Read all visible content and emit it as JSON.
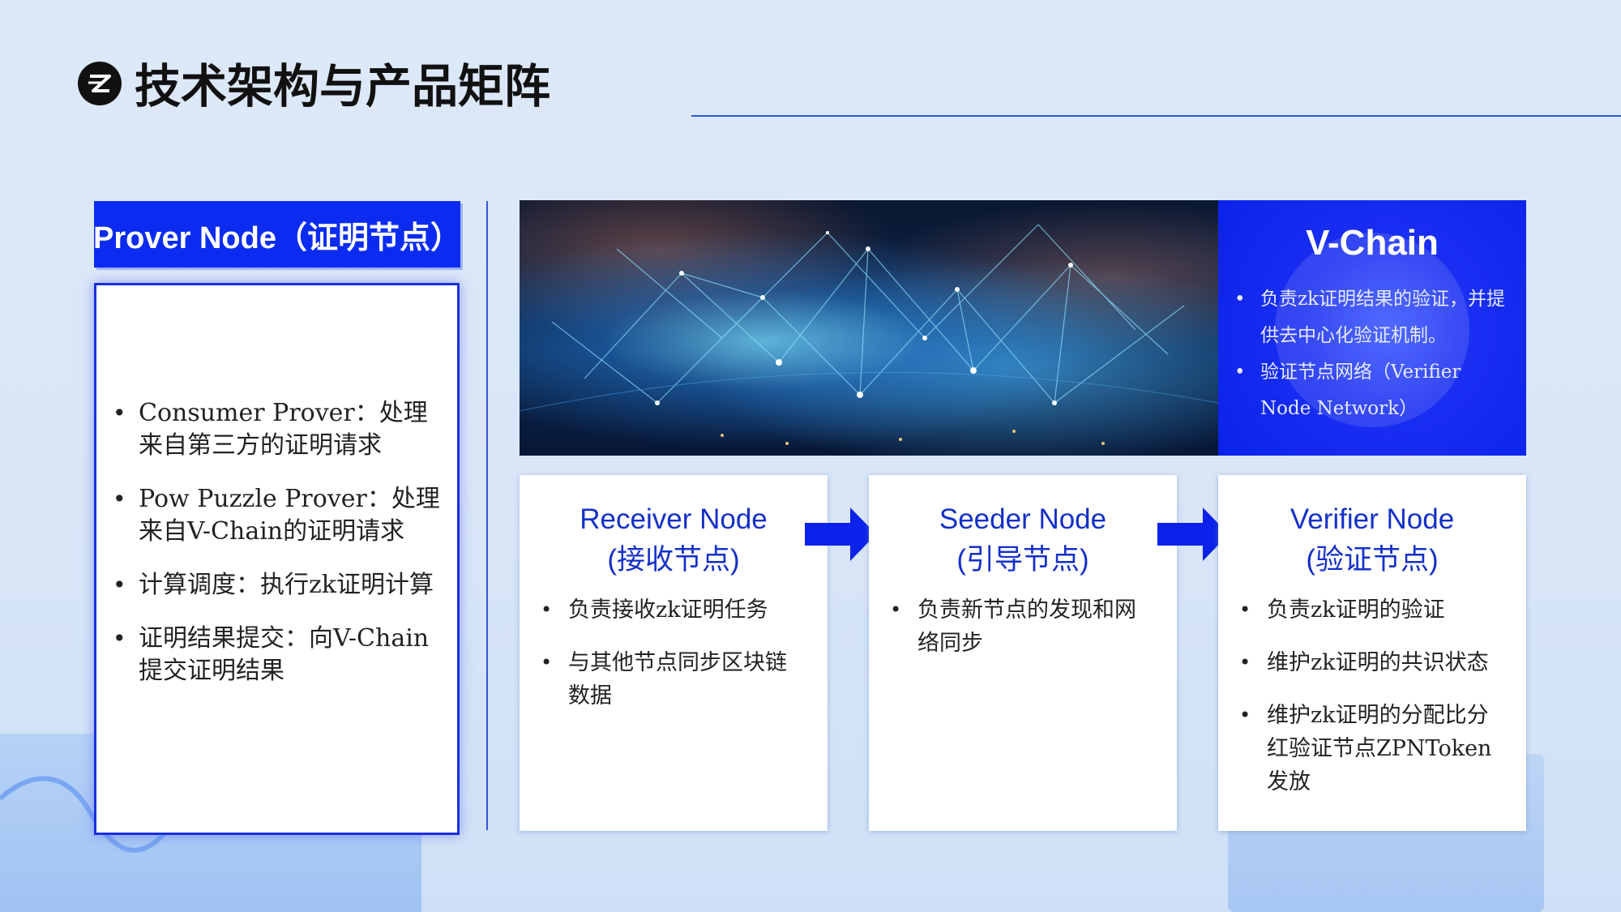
{
  "title": "技术架构与产品矩阵",
  "colors": {
    "accent": "#0b2cf0",
    "card_title": "#1430c8"
  },
  "prover": {
    "header": "Prover Node（证明节点）",
    "items": [
      "Consumer Prover：处理来自第三方的证明请求",
      "Pow Puzzle Prover：处理来自V-Chain的证明请求",
      "计算调度：执行zk证明计算",
      "证明结果提交：向V-Chain提交证明结果"
    ]
  },
  "vchain": {
    "title": "V-Chain",
    "items": [
      "负责zk证明结果的验证，并提供去中心化验证机制。",
      "验证节点网络（Verifier Node Network）"
    ]
  },
  "cards": [
    {
      "title_en": "Receiver Node",
      "title_cn": "(接收节点)",
      "items": [
        "负责接收zk证明任务",
        "与其他节点同步区块链数据"
      ]
    },
    {
      "title_en": "Seeder Node",
      "title_cn": "(引导节点)",
      "items": [
        "负责新节点的发现和网络同步"
      ]
    },
    {
      "title_en": "Verifier Node",
      "title_cn": "(验证节点)",
      "items": [
        "负责zk证明的验证",
        "维护zk证明的共识状态",
        "维护zk证明的分配比分红验证节点ZPNToken发放"
      ]
    }
  ]
}
